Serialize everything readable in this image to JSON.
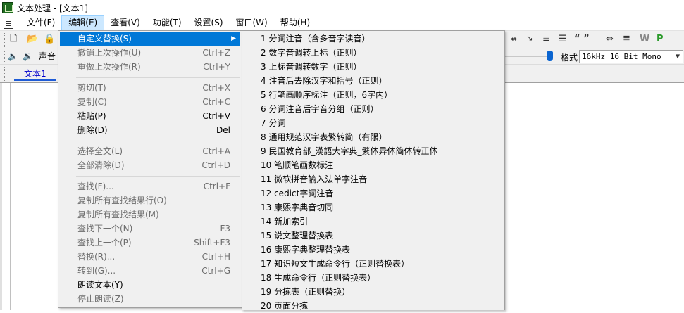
{
  "window": {
    "title": "文本处理 - [文本1]"
  },
  "menubar": {
    "items": [
      {
        "label": "文件(F)"
      },
      {
        "label": "编辑(E)"
      },
      {
        "label": "查看(V)"
      },
      {
        "label": "功能(T)"
      },
      {
        "label": "设置(S)"
      },
      {
        "label": "窗口(W)"
      },
      {
        "label": "帮助(H)"
      }
    ]
  },
  "toolbar": {
    "sound_label": "声音",
    "format_label": "格式",
    "format_value": "16kHz 16 Bit Mono",
    "playback_position": 0.88,
    "right_icons": [
      "format-icon-1",
      "format-icon-2",
      "format-icon-3",
      "format-icon-4",
      "quote-icon",
      "align-icon",
      "numbering-icon",
      "w-icon",
      "p-icon"
    ]
  },
  "document": {
    "tab_label": "文本1"
  },
  "edit_menu": {
    "items": [
      {
        "label": "自定义替换(S)",
        "shortcut": "",
        "state": "highlighted"
      },
      {
        "label": "撤销上次操作(U)",
        "shortcut": "Ctrl+Z",
        "state": "disabled"
      },
      {
        "label": "重做上次操作(R)",
        "shortcut": "Ctrl+Y",
        "state": "disabled"
      },
      {
        "label": "剪切(T)",
        "shortcut": "Ctrl+X",
        "state": "disabled"
      },
      {
        "label": "复制(C)",
        "shortcut": "Ctrl+C",
        "state": "disabled"
      },
      {
        "label": "粘贴(P)",
        "shortcut": "Ctrl+V",
        "state": "enabled"
      },
      {
        "label": "删除(D)",
        "shortcut": "Del",
        "state": "enabled"
      },
      {
        "label": "选择全文(L)",
        "shortcut": "Ctrl+A",
        "state": "disabled"
      },
      {
        "label": "全部清除(D)",
        "shortcut": "Ctrl+D",
        "state": "disabled"
      },
      {
        "label": "查找(F)...",
        "shortcut": "Ctrl+F",
        "state": "disabled"
      },
      {
        "label": "复制所有查找结果行(O)",
        "shortcut": "",
        "state": "disabled"
      },
      {
        "label": "复制所有查找结果(M)",
        "shortcut": "",
        "state": "disabled"
      },
      {
        "label": "查找下一个(N)",
        "shortcut": "F3",
        "state": "disabled"
      },
      {
        "label": "查找上一个(P)",
        "shortcut": "Shift+F3",
        "state": "disabled"
      },
      {
        "label": "替换(R)...",
        "shortcut": "Ctrl+H",
        "state": "disabled"
      },
      {
        "label": "转到(G)...",
        "shortcut": "Ctrl+G",
        "state": "disabled"
      },
      {
        "label": "朗读文本(Y)",
        "shortcut": "",
        "state": "enabled"
      },
      {
        "label": "停止朗读(Z)",
        "shortcut": "",
        "state": "disabled"
      }
    ]
  },
  "submenu": {
    "items": [
      "1 分词注音（含多音字读音）",
      "2 数字音调转上标（正则）",
      "3 上标音调转数字（正则）",
      "4 注音后去除汉字和括号（正则）",
      "5 行笔画顺序标注（正则，6字内）",
      "6 分词注音后字音分组（正则）",
      "7 分词",
      "8 通用规范汉字表繁转简（有限）",
      "9 民国教育部_漢語大字典_繁体异体简体转正体",
      "10 笔顺笔画数标注",
      "11 微软拼音输入法单字注音",
      "12 cedict字词注音",
      "13 康熙字典音切同",
      "14 新加索引",
      "15 说文整理替换表",
      "16 康熙字典整理替换表",
      "17 知识短文生成命令行（正则替换表）",
      "18 生成命令行（正则替换表）",
      "19 分拣表（正则替换）",
      "20 页面分拣"
    ]
  },
  "colors": {
    "menu_highlight": "#0078d7",
    "menubar_active": "#cce8ff",
    "tab_text": "#0000cc"
  }
}
